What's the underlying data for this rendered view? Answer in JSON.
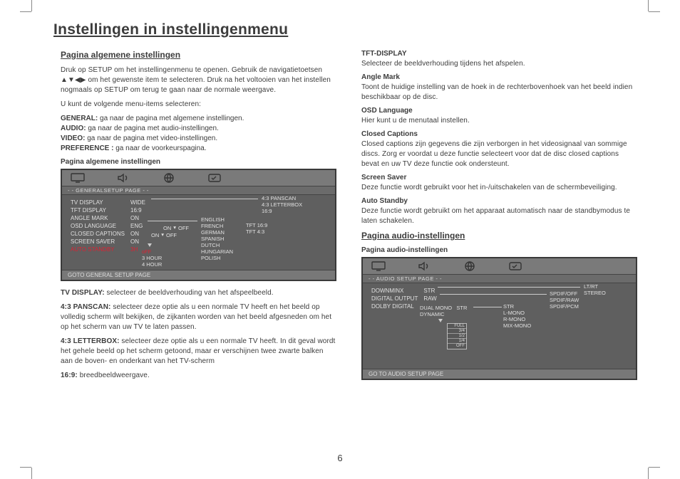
{
  "page_number": "6",
  "title": "Instellingen in instellingenmenu",
  "left": {
    "heading": "Pagina algemene instellingen",
    "intro": "Druk op SETUP om het instellingenmenu te openen. Gebruik de navigatietoetsen ▲▼◀▶ om het gewenste item te selecteren. Druk na het voltooien van het instellen nogmaals op SETUP om terug te gaan naar de normale weergave.",
    "intro2": "U kunt de volgende menu-items selecteren:",
    "menu": {
      "general_label": "GENERAL:",
      "general_text": " ga naar de pagina met algemene instellingen.",
      "audio_label": "AUDIO:",
      "audio_text": " ga naar de pagina met audio-instellingen.",
      "video_label": "VIDEO:",
      "video_text": " ga naar de pagina met video-instellingen.",
      "pref_label": "PREFERENCE :",
      "pref_text": " ga naar de voorkeurspagina."
    },
    "osd_caption": "Pagina algemene instellingen",
    "osd": {
      "titlebar": "- -  GENERALSETUP PAGE  - -",
      "rows": [
        [
          "TV DISPLAY",
          "WIDE"
        ],
        [
          "TFT DISPLAY",
          "16:9"
        ],
        [
          "ANGLE MARK",
          "ON"
        ],
        [
          "OSD LANGUAGE",
          "ENG"
        ],
        [
          "CLOSED CAPTIONS",
          "ON"
        ],
        [
          "SCREEN SAVER",
          "ON"
        ],
        [
          "AUTO STANDBY",
          "3H"
        ]
      ],
      "branch_tv": [
        "4:3 PANSCAN",
        "4:3 LETTERBOX",
        "16:9"
      ],
      "branch_cc": [
        "ON",
        "OFF"
      ],
      "branch_ss": [
        "ON",
        "OFF"
      ],
      "branch_auto": [
        "oFF",
        "3 HOUR",
        "4 HOUR"
      ],
      "branch_lang": [
        "ENGLISH",
        "FRENCH",
        "GERMAN",
        "SPANISH",
        "DUTCH",
        "HUNGARIAN",
        "POLISH"
      ],
      "branch_tft": [
        "TFT 16:9",
        "TFT 4:3"
      ],
      "footer": "GOTO GENERAL SETUP PAGE"
    },
    "tvdisplay_label": "TV DISPLAY:",
    "tvdisplay_text": " selecteer de beeldverhouding van het afspeelbeeld.",
    "panscan_label": "4:3 PANSCAN:",
    "panscan_text": " selecteer deze optie als u een normale TV heeft en het beeld op volledig scherm wilt bekijken, de zijkanten worden van het beeld afgesneden om het op het scherm van uw TV te laten passen.",
    "letterbox_label": "4:3 LETTERBOX:",
    "letterbox_text": " selecteer deze optie als u een normale TV heeft. In dit geval wordt het gehele beeld op het scherm getoond, maar er verschijnen twee zwarte balken aan de boven- en onderkant van het TV-scherm",
    "r169_label": "16:9:",
    "r169_text": " breedbeeldweergave."
  },
  "right": {
    "tft_label": "TFT-DISPLAY",
    "tft_text": "Selecteer de beeldverhouding tijdens het afspelen.",
    "angle_label": "Angle Mark",
    "angle_text": "Toont de huidige instelling van de hoek in de rechterbovenhoek van het beeld indien beschikbaar op de disc.",
    "osdlang_label": "OSD Language",
    "osdlang_text": "Hier kunt u de menutaal instellen.",
    "cc_label": "Closed Captions",
    "cc_text": "Closed captions zijn gegevens die zijn verborgen in het videosignaal van sommige discs. Zorg er voordat u deze functie selecteert voor dat de disc closed captions bevat en uw TV deze functie ook ondersteunt.",
    "ss_label": "Screen Saver",
    "ss_text": "Deze functie wordt gebruikt voor het in-/uitschakelen van de schermbeveiliging.",
    "as_label": "Auto Standby",
    "as_text": "Deze functie wordt gebruikt om het apparaat automatisch naar de standbymodus te laten schakelen.",
    "heading2": "Pagina audio-instellingen",
    "osd_caption": "Pagina audio-instellingen",
    "osd": {
      "titlebar": "- -   AUDIO SETUP PAGE   - -",
      "rows": [
        [
          "DOWNMINX",
          "STR"
        ],
        [
          "DIGITAL OUTPUT",
          "RAW"
        ],
        [
          "DOLBY DIGITAL",
          ""
        ]
      ],
      "branch_down": [
        "LT/RT",
        "STEREO"
      ],
      "branch_digital": [
        "SPDIF/OFF",
        "SPDIF/RAW",
        "SPDIF/PCM"
      ],
      "dolby_cols": [
        "DUAL MONO",
        "DYNAMIC"
      ],
      "dolby_dual": [
        "STR",
        "L-MONO",
        "R-MONO",
        "MIX-MONO"
      ],
      "dolby_val": "STR",
      "bar_ticks": [
        "FULL",
        "3/4",
        "1/2",
        "1/4",
        "OFF"
      ],
      "footer": "GO TO AUDIO SETUP PAGE"
    }
  }
}
